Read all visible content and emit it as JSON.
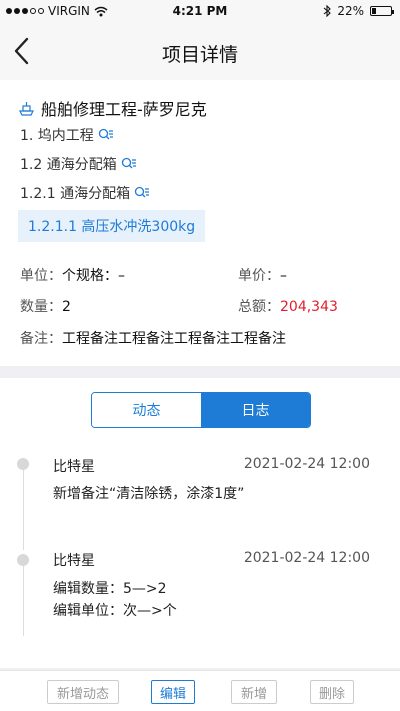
{
  "status_bar": {
    "carrier": "VIRGIN",
    "time": "4:21 PM",
    "battery": "22%",
    "battery_level": 0.22
  },
  "nav": {
    "title": "项目详情"
  },
  "project": {
    "title": "船舶修理工程-萨罗尼克",
    "path_1": "1. 坞内工程",
    "path_2": "1.2 通海分配箱",
    "path_3": "1.2.1 通海分配箱",
    "selected_item": "1.2.1.1 高压水冲洗300kg",
    "unit_label": "单位：",
    "unit_value": "个规格：–",
    "price_label": "单价：",
    "price_value": "–",
    "qty_label": "数量：",
    "qty_value": "2",
    "total_label": "总额：",
    "total_value": "204,343",
    "note_label": "备注：",
    "note_value": "工程备注工程备注工程备注工程备注"
  },
  "tabs": {
    "dynamic": "动态",
    "log": "日志"
  },
  "log": [
    {
      "name": "比特星",
      "time": "2021-02-24 12:00",
      "line1": "新增备注“清洁除锈，涂漆1度”",
      "line2": ""
    },
    {
      "name": "比特星",
      "time": "2021-02-24 12:00",
      "line1": "编辑数量：5—>2",
      "line2": "编辑单位：次—>个"
    }
  ],
  "toolbar": {
    "add_dynamic": "新增动态",
    "edit": "编辑",
    "add": "新增",
    "delete": "删除"
  },
  "colors": {
    "accent": "#1e7cd6",
    "total": "#e0202e"
  }
}
